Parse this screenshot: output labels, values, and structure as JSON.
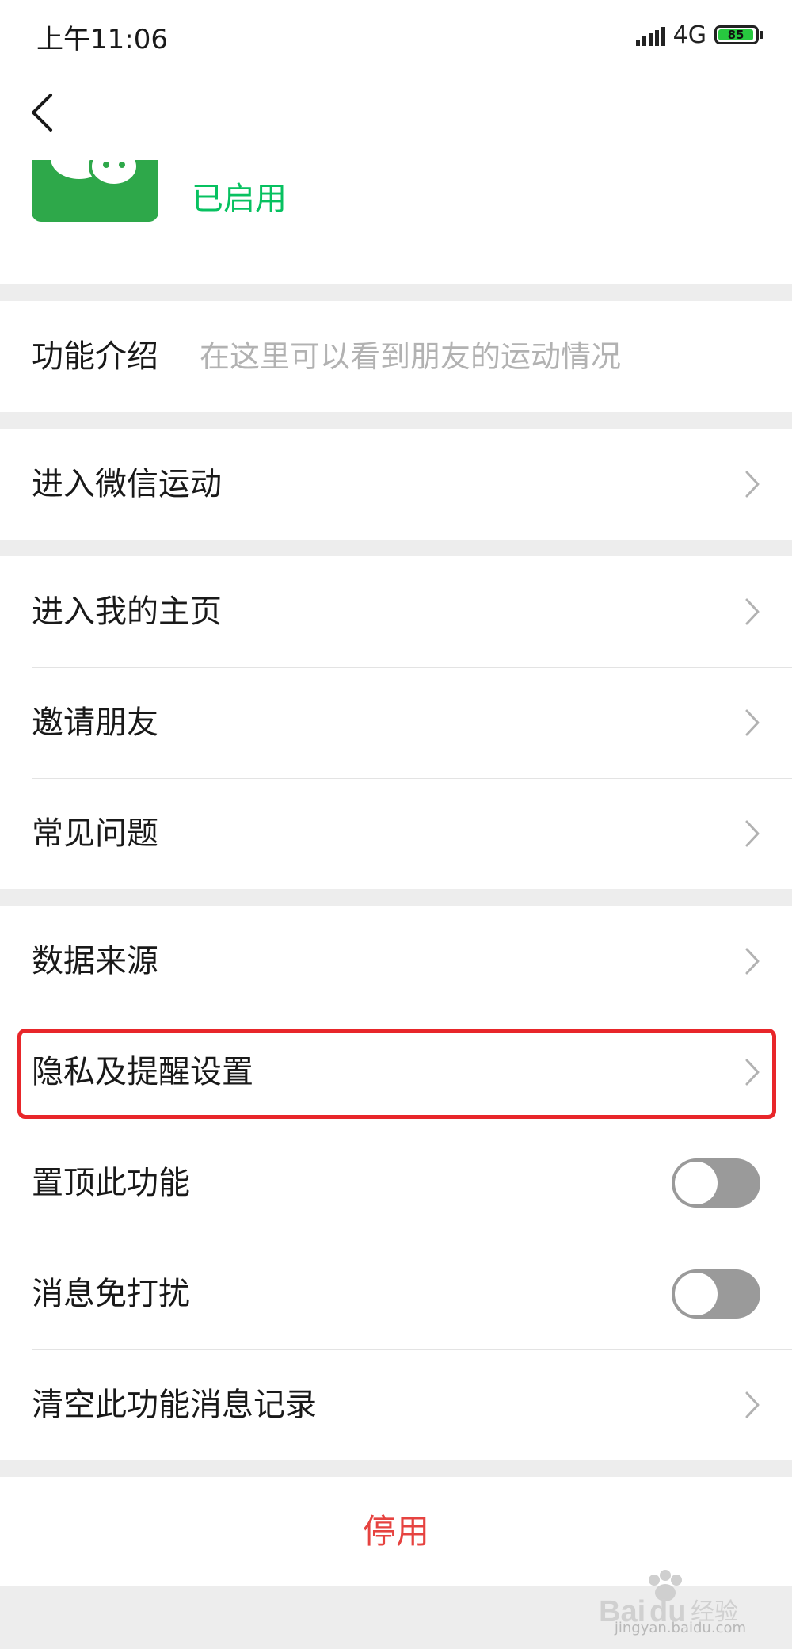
{
  "status_bar": {
    "time": "上午11:06",
    "network": "4G",
    "battery": "85"
  },
  "header": {
    "status": "已启用"
  },
  "intro": {
    "label": "功能介绍",
    "description": "在这里可以看到朋友的运动情况"
  },
  "group1": {
    "enter_sport": "进入微信运动"
  },
  "group2": {
    "my_home": "进入我的主页",
    "invite": "邀请朋友",
    "faq": "常见问题"
  },
  "group3": {
    "data_source": "数据来源",
    "privacy": "隐私及提醒设置",
    "pin_top": "置顶此功能",
    "mute": "消息免打扰",
    "clear_history": "清空此功能消息记录"
  },
  "toggles": {
    "pin_top_on": false,
    "mute_on": false
  },
  "footer": {
    "disable": "停用"
  },
  "watermark": {
    "text": "jingyan.baidu.com",
    "logo_text": "Baidu经验"
  },
  "colors": {
    "accent_green": "#07c160",
    "danger_red": "#e64340",
    "highlight_red": "#e8262a"
  }
}
